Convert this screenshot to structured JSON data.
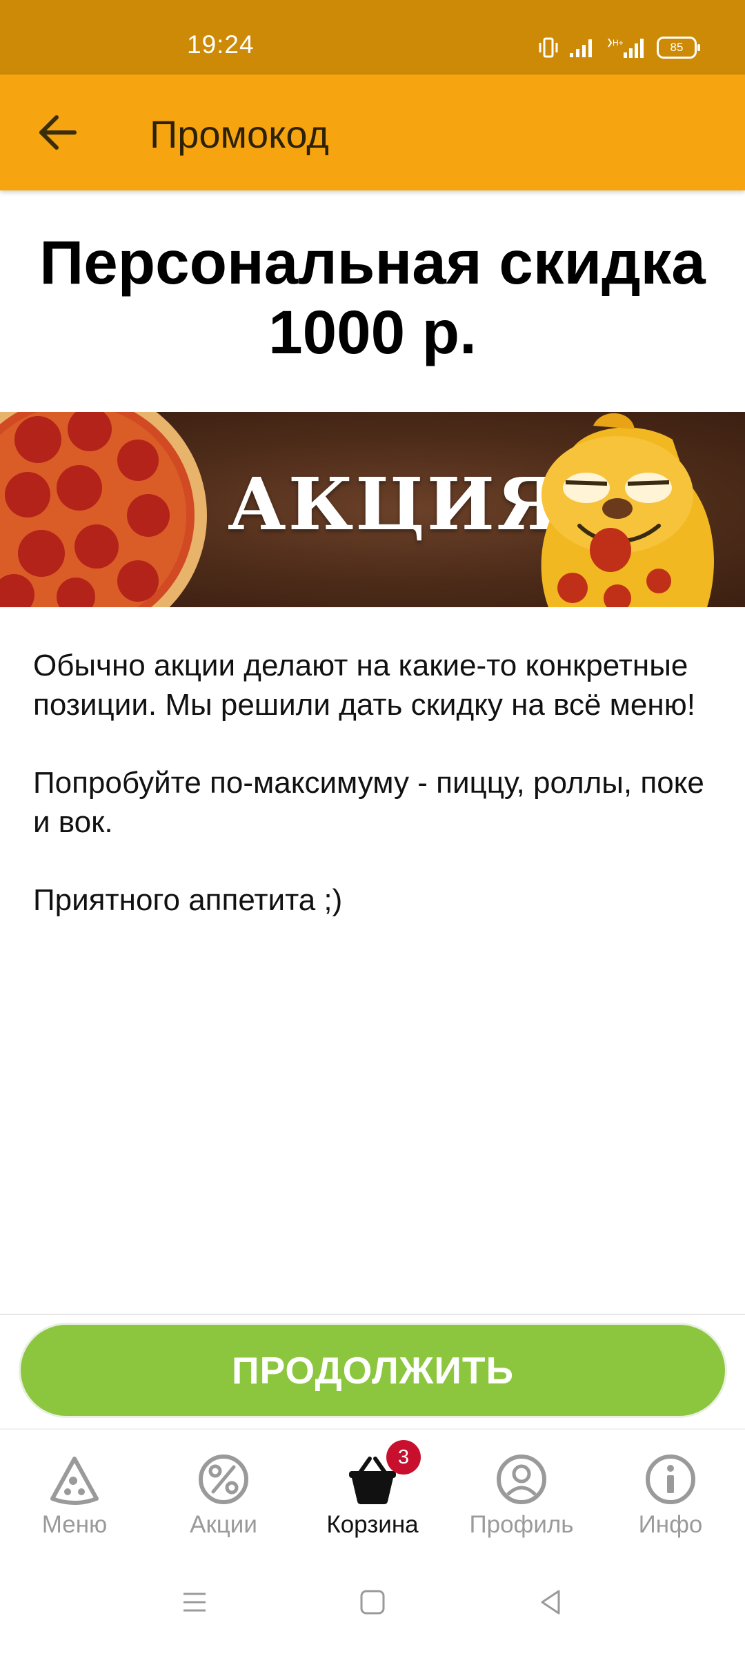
{
  "status_bar": {
    "time": "19:24",
    "battery": "85"
  },
  "app_bar": {
    "title": "Промокод"
  },
  "promo": {
    "headline_line1": "Персональная скидка",
    "headline_line2": "1000 р.",
    "banner_text": "АКЦИЯ",
    "paragraphs": [
      "Обычно акции делают на какие-то конкретные позиции. Мы решили дать скидку на всё меню!",
      "Попробуйте по-максимуму - пиццу, роллы, поке и вок.",
      "Приятного аппетита ;)"
    ]
  },
  "cta": {
    "label": "ПРОДОЛЖИТЬ"
  },
  "bottom_nav": {
    "items": [
      {
        "label": "Меню",
        "icon": "pizza-slice-icon"
      },
      {
        "label": "Акции",
        "icon": "percent-icon"
      },
      {
        "label": "Корзина",
        "icon": "basket-icon",
        "badge": "3",
        "active": true
      },
      {
        "label": "Профиль",
        "icon": "profile-icon"
      },
      {
        "label": "Инфо",
        "icon": "info-icon"
      }
    ]
  },
  "colors": {
    "status_bar": "#cd8a07",
    "app_bar": "#f6a511",
    "cta": "#8cc63f",
    "badge": "#c8102e"
  }
}
